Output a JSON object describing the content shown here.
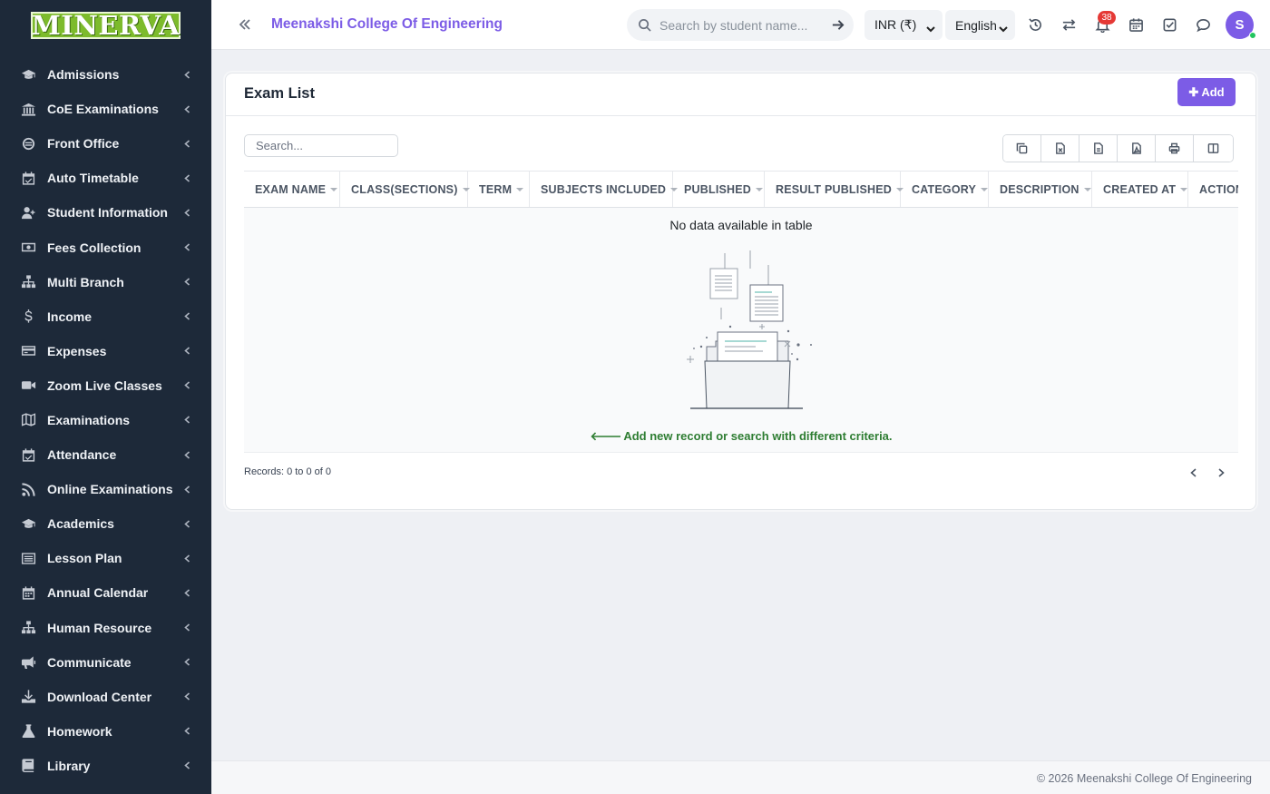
{
  "brand": {
    "logo_text": "MINERVA"
  },
  "sidebar": {
    "items": [
      {
        "label": "Admissions",
        "icon": "graduation-cap-icon"
      },
      {
        "label": "CoE Examinations",
        "icon": "bank-icon"
      },
      {
        "label": "Front Office",
        "icon": "front-office-icon"
      },
      {
        "label": "Auto Timetable",
        "icon": "calendar-check-icon"
      },
      {
        "label": "Student Information",
        "icon": "user-plus-icon"
      },
      {
        "label": "Fees Collection",
        "icon": "money-bill-icon"
      },
      {
        "label": "Multi Branch",
        "icon": "sitemap-icon"
      },
      {
        "label": "Income",
        "icon": "dollar-icon"
      },
      {
        "label": "Expenses",
        "icon": "credit-card-icon"
      },
      {
        "label": "Zoom Live Classes",
        "icon": "video-camera-icon"
      },
      {
        "label": "Examinations",
        "icon": "map-icon"
      },
      {
        "label": "Attendance",
        "icon": "calendar-check-icon"
      },
      {
        "label": "Online Examinations",
        "icon": "rss-icon"
      },
      {
        "label": "Academics",
        "icon": "graduation-cap-icon"
      },
      {
        "label": "Lesson Plan",
        "icon": "list-alt-icon"
      },
      {
        "label": "Annual Calendar",
        "icon": "calendar-icon"
      },
      {
        "label": "Human Resource",
        "icon": "sitemap-icon"
      },
      {
        "label": "Communicate",
        "icon": "bullhorn-icon"
      },
      {
        "label": "Download Center",
        "icon": "download-icon"
      },
      {
        "label": "Homework",
        "icon": "flask-icon"
      },
      {
        "label": "Library",
        "icon": "book-icon"
      }
    ]
  },
  "header": {
    "college_name": "Meenakshi College Of Engineering",
    "search_placeholder": "Search by student name...",
    "currency": "INR (₹)",
    "language": "English",
    "notification_count": "38",
    "avatar_initial": "S"
  },
  "card": {
    "title": "Exam List",
    "add_label": "Add",
    "search_placeholder": "Search...",
    "tools": [
      "copy-icon",
      "excel-icon",
      "csv-icon",
      "pdf-icon",
      "print-icon",
      "columns-icon"
    ],
    "columns": [
      "EXAM NAME",
      "CLASS(SECTIONS)",
      "TERM",
      "SUBJECTS INCLUDED",
      "PUBLISHED",
      "RESULT PUBLISHED",
      "CATEGORY",
      "DESCRIPTION",
      "CREATED AT",
      "ACTION"
    ],
    "empty_text": "No data available in table",
    "empty_hint": "Add new record or search with different criteria.",
    "records_text": "Records: 0 to 0 of 0"
  },
  "footer": {
    "text": "© 2026 Meenakshi College Of Engineering"
  },
  "colors": {
    "accent": "#7c5ce6",
    "sidebar_bg": "#1d2939",
    "hint": "#2e7d32",
    "badge": "#e53935"
  }
}
